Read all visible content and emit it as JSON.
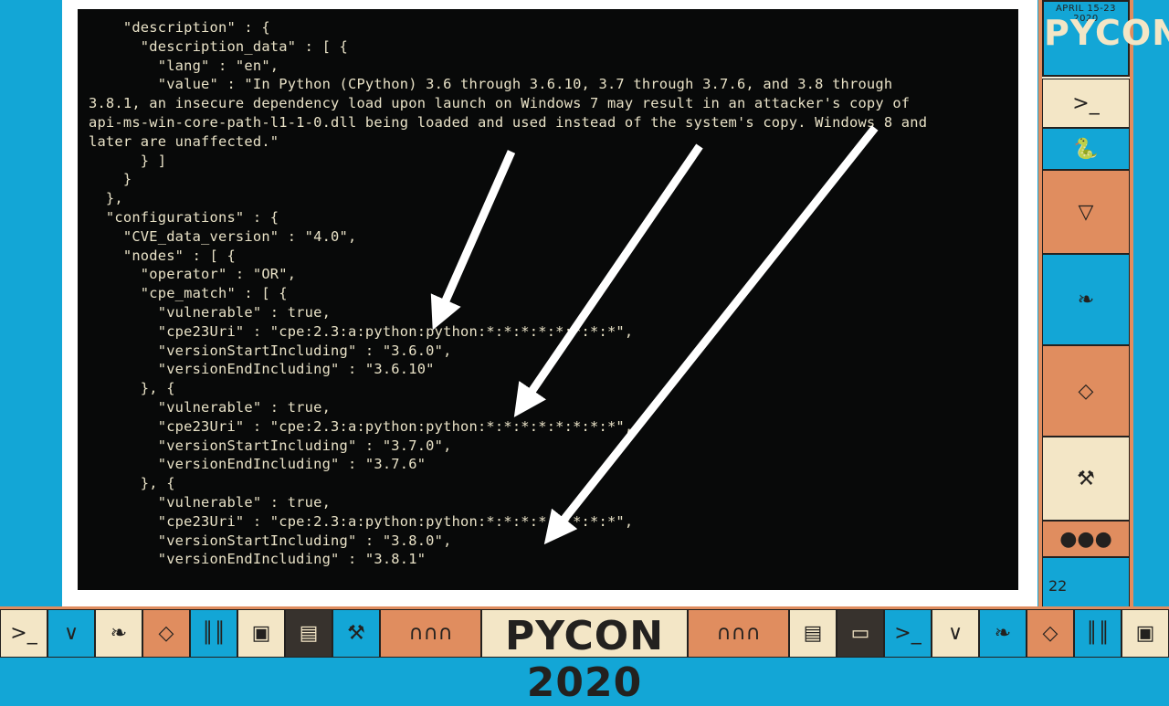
{
  "slide": {
    "code_lines": [
      "    \"description\" : {",
      "      \"description_data\" : [ {",
      "        \"lang\" : \"en\",",
      "        \"value\" : \"In Python (CPython) 3.6 through 3.6.10, 3.7 through 3.7.6, and 3.8 through",
      "3.8.1, an insecure dependency load upon launch on Windows 7 may result in an attacker's copy of",
      "api-ms-win-core-path-l1-1-0.dll being loaded and used instead of the system's copy. Windows 8 and",
      "later are unaffected.\"",
      "      } ]",
      "    }",
      "  },",
      "  \"configurations\" : {",
      "    \"CVE_data_version\" : \"4.0\",",
      "    \"nodes\" : [ {",
      "      \"operator\" : \"OR\",",
      "      \"cpe_match\" : [ {",
      "        \"vulnerable\" : true,",
      "        \"cpe23Uri\" : \"cpe:2.3:a:python:python:*:*:*:*:*:*:*:*\",",
      "        \"versionStartIncluding\" : \"3.6.0\",",
      "        \"versionEndIncluding\" : \"3.6.10\"",
      "      }, {",
      "        \"vulnerable\" : true,",
      "        \"cpe23Uri\" : \"cpe:2.3:a:python:python:*:*:*:*:*:*:*:*\",",
      "        \"versionStartIncluding\" : \"3.7.0\",",
      "        \"versionEndIncluding\" : \"3.7.6\"",
      "      }, {",
      "        \"vulnerable\" : true,",
      "        \"cpe23Uri\" : \"cpe:2.3:a:python:python:*:*:*:*:*:*:*:*\",",
      "        \"versionStartIncluding\" : \"3.8.0\",",
      "        \"versionEndIncluding\" : \"3.8.1\""
    ],
    "page_number": "22",
    "arrow_color": "#ffffff",
    "terminal_bg": "#080909",
    "text_color": "#e9e2c7"
  },
  "branding": {
    "bottom_logo": "PYCON 2020",
    "top_logo": "PYCON",
    "top_date": "APRIL 15-23 2020",
    "frame_blue": "#13a6d6",
    "frame_orange": "#e08d5f",
    "frame_cream": "#f3e6c6"
  },
  "decor_icons": [
    "terminal-prompt-icon",
    "snake-icon",
    "wave-icon",
    "leaf-icon",
    "diamond-icon",
    "robot-icon",
    "tools-icon",
    "bridge-icon"
  ]
}
